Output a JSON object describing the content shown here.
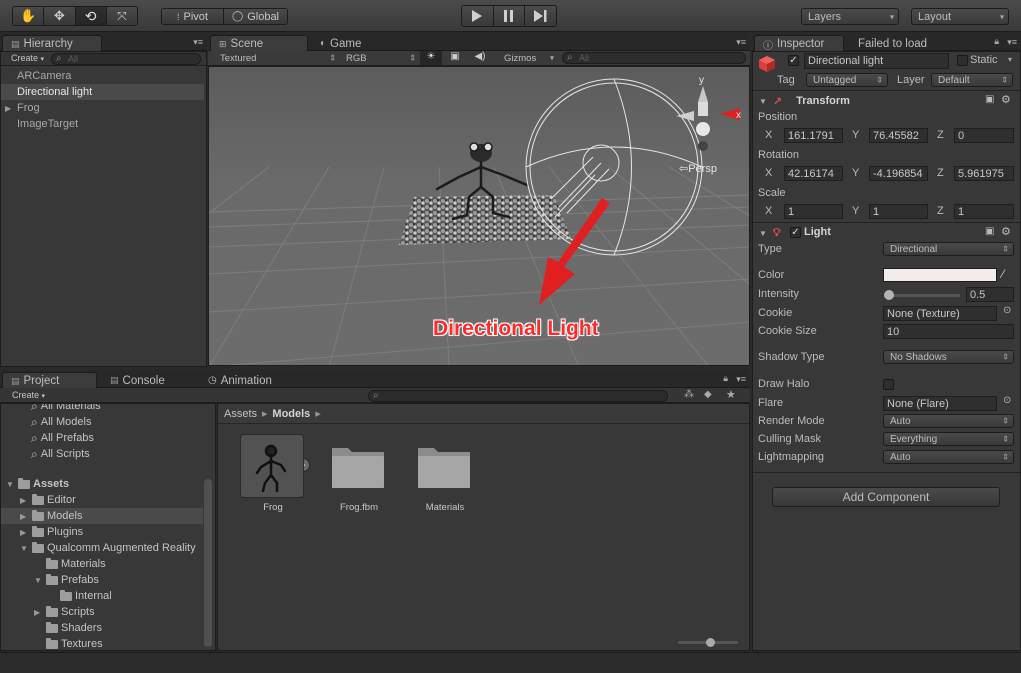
{
  "toolbar": {
    "pivot_label": "Pivot",
    "global_label": "Global",
    "layers_label": "Layers",
    "layout_label": "Layout"
  },
  "hierarchy": {
    "tab_label": "Hierarchy",
    "create_label": "Create",
    "search_placeholder": "All",
    "items": [
      {
        "label": "ARCamera",
        "selected": false,
        "expandable": false
      },
      {
        "label": "Directional light",
        "selected": true,
        "expandable": false
      },
      {
        "label": "Frog",
        "selected": false,
        "expandable": true
      },
      {
        "label": "ImageTarget",
        "selected": false,
        "expandable": false
      }
    ]
  },
  "scene": {
    "tab_scene": "Scene",
    "tab_game": "Game",
    "render_mode": "Textured",
    "color_mode": "RGB",
    "gizmos_label": "Gizmos",
    "search_placeholder": "All",
    "persp_label": "Persp",
    "gizmo_x": "x",
    "gizmo_y": "y",
    "annotation": "Directional Light"
  },
  "project": {
    "tab_project": "Project",
    "tab_console": "Console",
    "tab_animation": "Animation",
    "create_label": "Create",
    "favorites": [
      "All Materials",
      "All Models",
      "All Prefabs",
      "All Scripts"
    ],
    "tree": [
      {
        "label": "Assets",
        "indent": 0,
        "tri": "▼",
        "bold": true
      },
      {
        "label": "Editor",
        "indent": 1,
        "tri": "▶"
      },
      {
        "label": "Models",
        "indent": 1,
        "tri": "▶",
        "selected": true
      },
      {
        "label": "Plugins",
        "indent": 1,
        "tri": "▶"
      },
      {
        "label": "Qualcomm Augmented Reality",
        "indent": 1,
        "tri": "▼"
      },
      {
        "label": "Materials",
        "indent": 2,
        "tri": ""
      },
      {
        "label": "Prefabs",
        "indent": 2,
        "tri": "▼"
      },
      {
        "label": "Internal",
        "indent": 3,
        "tri": ""
      },
      {
        "label": "Scripts",
        "indent": 2,
        "tri": "▶"
      },
      {
        "label": "Shaders",
        "indent": 2,
        "tri": ""
      },
      {
        "label": "Textures",
        "indent": 2,
        "tri": ""
      }
    ],
    "breadcrumb_root": "Assets",
    "breadcrumb_current": "Models",
    "assets": [
      {
        "label": "Frog",
        "kind": "model"
      },
      {
        "label": "Frog.fbm",
        "kind": "folder"
      },
      {
        "label": "Materials",
        "kind": "folder"
      }
    ]
  },
  "inspector": {
    "tab_label": "Inspector",
    "failed_label": "Failed to load",
    "object_name": "Directional light",
    "static_label": "Static",
    "tag_label": "Tag",
    "tag_value": "Untagged",
    "layer_label": "Layer",
    "layer_value": "Default",
    "transform": {
      "title": "Transform",
      "position_label": "Position",
      "rotation_label": "Rotation",
      "scale_label": "Scale",
      "x": "X",
      "y": "Y",
      "z": "Z",
      "position": [
        "161.1791",
        "76.45582",
        "0"
      ],
      "rotation": [
        "42.16174",
        "-4.196854",
        "5.961975"
      ],
      "scale": [
        "1",
        "1",
        "1"
      ]
    },
    "light": {
      "title": "Light",
      "type_label": "Type",
      "type_value": "Directional",
      "color_label": "Color",
      "color_value": "#f4ebeb",
      "intensity_label": "Intensity",
      "intensity_value": "0.5",
      "cookie_label": "Cookie",
      "cookie_value": "None (Texture)",
      "cookie_size_label": "Cookie Size",
      "cookie_size_value": "10",
      "shadow_type_label": "Shadow Type",
      "shadow_type_value": "No Shadows",
      "draw_halo_label": "Draw Halo",
      "flare_label": "Flare",
      "flare_value": "None (Flare)",
      "render_mode_label": "Render Mode",
      "render_mode_value": "Auto",
      "culling_mask_label": "Culling Mask",
      "culling_mask_value": "Everything",
      "lightmapping_label": "Lightmapping",
      "lightmapping_value": "Auto"
    },
    "add_component_label": "Add Component"
  },
  "colors": {
    "annotation_text": "#ff2b2b",
    "arrow": "#e02020",
    "selection": "#3e5f96",
    "panel_bg": "#383838"
  }
}
